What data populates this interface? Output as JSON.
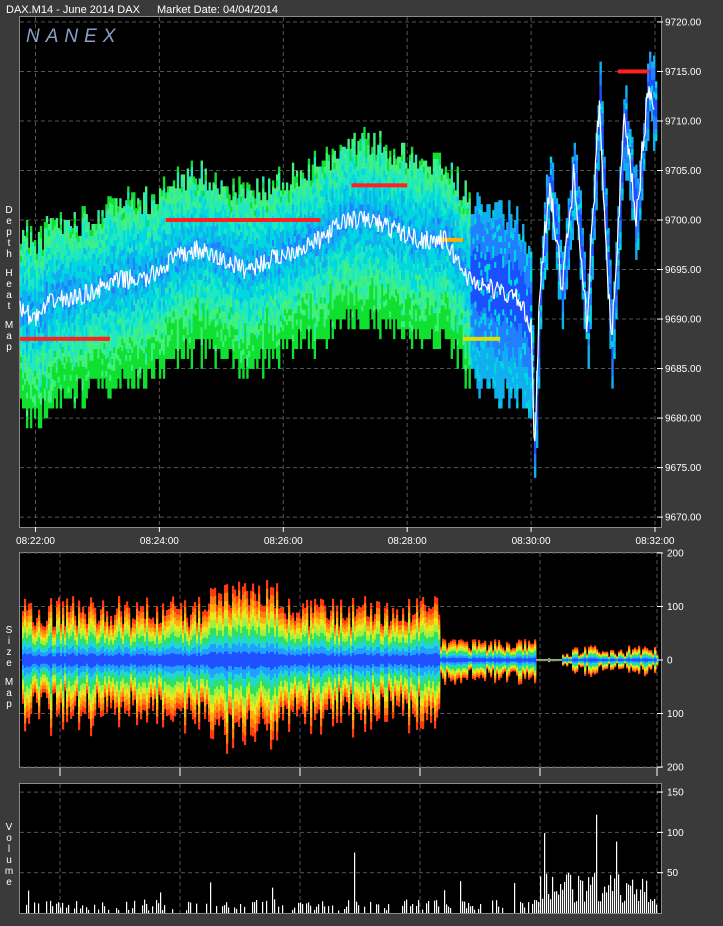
{
  "header": {
    "symbol": "DAX.M14 - June 2014 DAX",
    "market_date": "Market Date: 04/04/2014"
  },
  "logo": "NANEX",
  "panels": {
    "depth_label": "Depth Heat Map",
    "size_label": "Size Map",
    "volume_label": "Volume"
  },
  "colors": {
    "panel_bg": "#000000",
    "grid": "#555555",
    "trade": "#ffffff",
    "heat_low": "#1a3cff",
    "heat_mid": "#00e0e0",
    "heat_high": "#00ff00",
    "heat_top": "#ff2020"
  },
  "chart_data": [
    {
      "type": "heatmap",
      "title": "Depth Heat Map",
      "x_ticks": [
        "08:22:00",
        "08:24:00",
        "08:26:00",
        "08:28:00",
        "08:30:00",
        "08:32:00"
      ],
      "y_ticks": [
        "9720.00",
        "9715.00",
        "9710.00",
        "9705.00",
        "9700.00",
        "9695.00",
        "9690.00",
        "9685.00",
        "9680.00",
        "9675.00",
        "9670.00"
      ],
      "ylim": [
        9669,
        9720.5
      ],
      "xlim_minutes": [
        21.75,
        32.0
      ],
      "grid": true,
      "price_path": {
        "time_minutes": [
          21.75,
          22.0,
          22.3,
          22.6,
          23.0,
          23.4,
          23.8,
          24.2,
          24.6,
          25.0,
          25.4,
          25.8,
          26.2,
          26.6,
          27.0,
          27.4,
          27.8,
          28.2,
          28.6,
          29.0,
          29.4,
          29.8,
          30.0,
          30.05,
          30.15,
          30.3,
          30.5,
          30.7,
          30.9,
          31.1,
          31.3,
          31.5,
          31.7,
          31.9,
          32.0
        ],
        "price": [
          9691,
          9690,
          9692,
          9692,
          9693,
          9694,
          9694,
          9696,
          9697,
          9696,
          9695,
          9696,
          9697,
          9698,
          9700,
          9700,
          9699,
          9698,
          9698,
          9694,
          9693,
          9692,
          9689,
          9676,
          9694,
          9704,
          9693,
          9705,
          9689,
          9712,
          9687,
          9710,
          9700,
          9714,
          9711
        ]
      }
    },
    {
      "type": "area",
      "title": "Size Map",
      "y_ticks": [
        "200",
        "100",
        "0",
        "100",
        "200"
      ],
      "ylim": [
        -200,
        200
      ]
    },
    {
      "type": "bar",
      "title": "Volume",
      "y_ticks": [
        "150",
        "100",
        "50"
      ],
      "ylim": [
        0,
        160
      ]
    }
  ]
}
